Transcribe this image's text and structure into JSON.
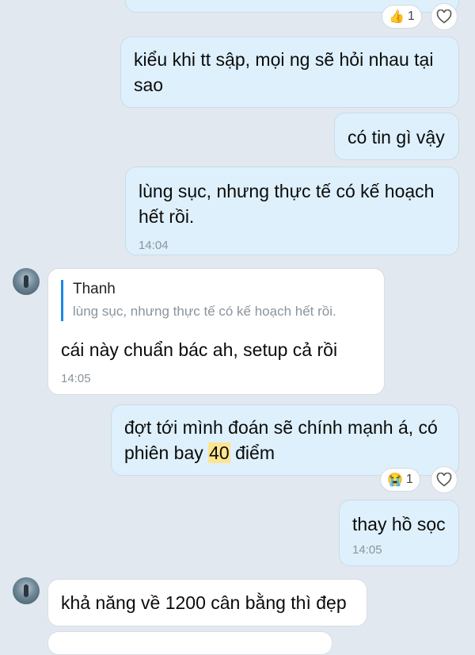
{
  "messages": [
    {
      "id": "m0",
      "side": "me",
      "text": ""
    },
    {
      "id": "m1",
      "side": "me",
      "text": "kiểu khi tt sập, mọi ng sẽ hỏi nhau tại sao"
    },
    {
      "id": "m2",
      "side": "me",
      "text": "có tin gì vậy"
    },
    {
      "id": "m3",
      "side": "me",
      "text": "lùng sục, nhưng thực tế có kế hoạch hết rồi.",
      "time": "14:04"
    },
    {
      "id": "m4",
      "side": "them",
      "quote_name": "Thanh",
      "quote_text": "lùng sục, nhưng thực tế có kế hoạch hết rồi.",
      "text": "cái này chuẩn bác ah, setup cả rồi",
      "time": "14:05"
    },
    {
      "id": "m5",
      "side": "me",
      "text_before": "đợt tới mình đoán sẽ chính mạnh á, có phiên bay ",
      "highlight": "40",
      "text_after": " điểm"
    },
    {
      "id": "m6",
      "side": "me",
      "text": "thay hồ sọc",
      "time": "14:05"
    },
    {
      "id": "m7",
      "side": "them",
      "text": "khả năng về 1200 cân bằng thì đẹp"
    }
  ],
  "reactions": [
    {
      "emoji": "👍",
      "icon": "thumbs-up-icon",
      "count": "1"
    },
    {
      "emoji": "😭",
      "icon": "crying-face-icon",
      "count": "1"
    }
  ]
}
